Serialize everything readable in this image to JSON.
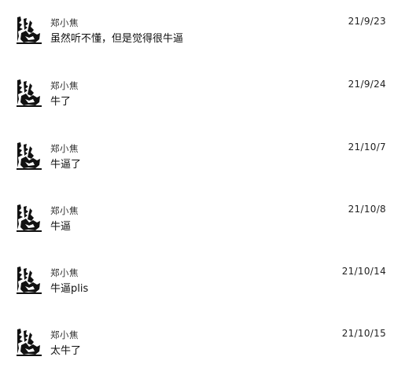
{
  "comments": [
    {
      "username": "郑小焦",
      "date": "21/9/23",
      "text": "虽然听不懂，但是觉得很牛逼"
    },
    {
      "username": "郑小焦",
      "date": "21/9/24",
      "text": "牛了"
    },
    {
      "username": "郑小焦",
      "date": "21/10/7",
      "text": "牛逼了"
    },
    {
      "username": "郑小焦",
      "date": "21/10/8",
      "text": "牛逼"
    },
    {
      "username": "郑小焦",
      "date": "21/10/14",
      "text": "牛逼plis"
    },
    {
      "username": "郑小焦",
      "date": "21/10/15",
      "text": "太牛了"
    }
  ]
}
